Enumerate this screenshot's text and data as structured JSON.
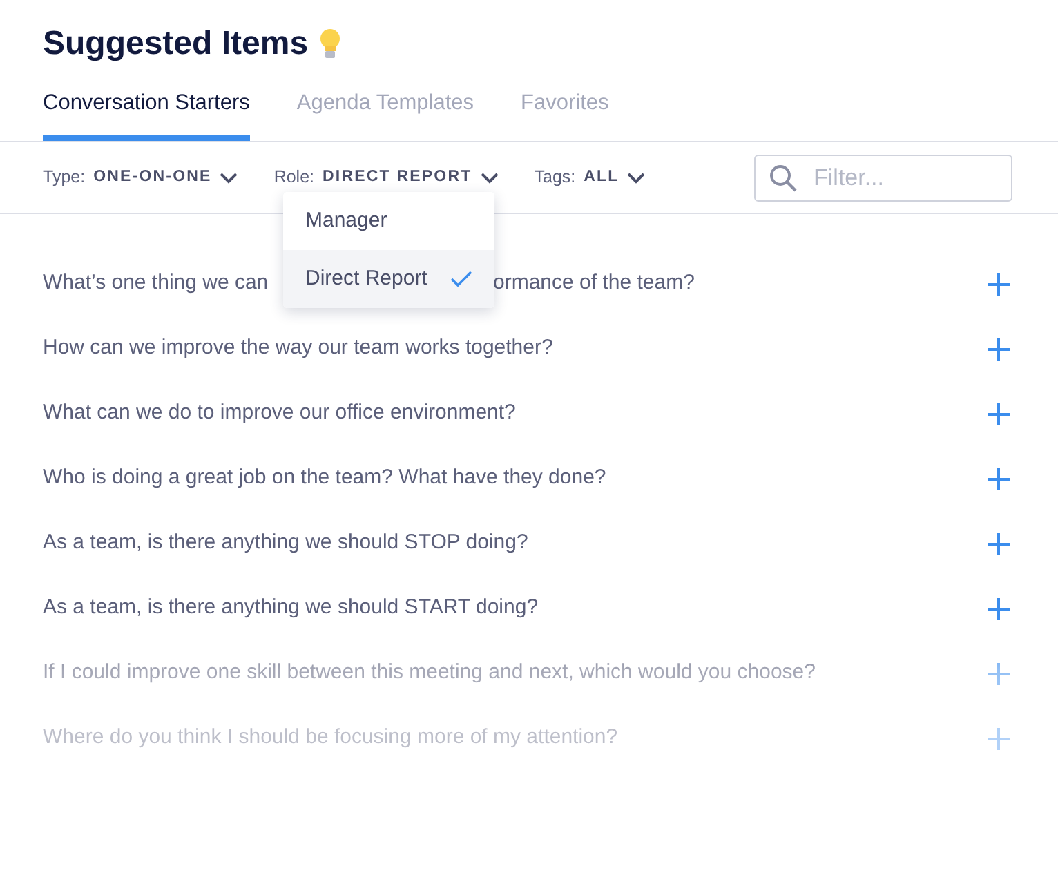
{
  "title": "Suggested Items",
  "tabs": [
    {
      "label": "Conversation Starters",
      "selected": true
    },
    {
      "label": "Agenda Templates",
      "selected": false
    },
    {
      "label": "Favorites",
      "selected": false
    }
  ],
  "filters": [
    {
      "label": "Type:",
      "value": "ONE-ON-ONE"
    },
    {
      "label": "Role:",
      "value": "DIRECT REPORT"
    },
    {
      "label": "Tags:",
      "value": "ALL"
    }
  ],
  "search": {
    "placeholder": "Filter..."
  },
  "role_menu": [
    {
      "label": "Manager",
      "selected": false
    },
    {
      "label": "Direct Report",
      "selected": true
    }
  ],
  "questions": [
    {
      "text": "What’s one thing we can",
      "text_end": "ormance of the team?"
    },
    {
      "text": "How can we improve the way our team works together?"
    },
    {
      "text": "What can we do to improve our office environment?"
    },
    {
      "text": "Who is doing a great job on the team? What have they done?"
    },
    {
      "text": "As a team, is there anything we should STOP doing?"
    },
    {
      "text": "As a team, is there anything we should START doing?"
    },
    {
      "text": "If I could improve one skill between this meeting and next, which would you choose?"
    },
    {
      "text": "Where do you think I should be focusing more of my attention?"
    }
  ]
}
